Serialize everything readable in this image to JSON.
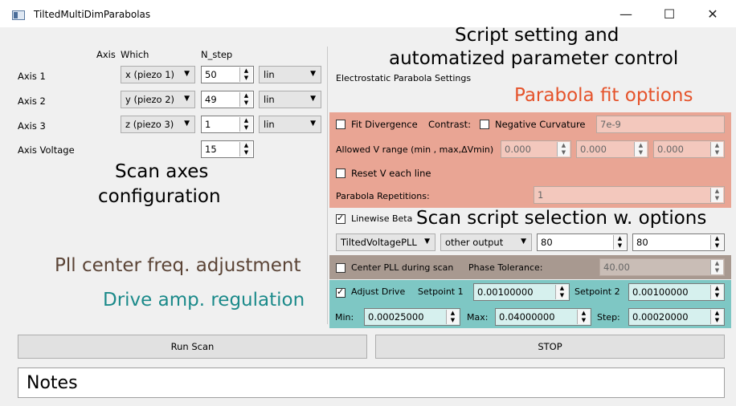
{
  "window": {
    "title": "TiltedMultiDimParabolas",
    "min_glyph": "—",
    "max_glyph": "☐",
    "close_glyph": "✕"
  },
  "annotations": {
    "script_setting": "Script setting and",
    "automatized": "automatized parameter control",
    "parabola_fit": "Parabola fit options",
    "scan_axes_1": "Scan axes",
    "scan_axes_2": "configuration",
    "scan_script": "Scan script selection w. options",
    "pll_center": "Pll center freq. adjustment",
    "drive_amp": "Drive amp. regulation",
    "colors": {
      "parabola": "#e5532b",
      "pll": "#5b4436",
      "drive": "#1b8a8a"
    }
  },
  "axes": {
    "header_axis": "Axis",
    "header_which": "Which",
    "header_nstep": "N_step",
    "rows": [
      {
        "label": "Axis 1",
        "which": "x (piezo 1)",
        "nstep": "50",
        "mode": "lin"
      },
      {
        "label": "Axis 2",
        "which": "y (piezo 2)",
        "nstep": "49",
        "mode": "lin"
      },
      {
        "label": "Axis 3",
        "which": "z (piezo 3)",
        "nstep": "1",
        "mode": "lin"
      }
    ],
    "voltage_label": "Axis Voltage",
    "voltage_value": "15"
  },
  "settings": {
    "title": "Electrostatic Parabola Settings",
    "fit_divergence": "Fit Divergence",
    "contrast": "Contrast:",
    "negative_curvature": "Negative Curvature",
    "curvature_value": "7e-9",
    "allowed_v": "Allowed V range (min , max,ΔVmin)",
    "v_min": "0.000",
    "v_max": "0.000",
    "v_delta": "0.000",
    "reset_v": "Reset V each line",
    "parabola_reps": "Parabola Repetitions:",
    "reps_value": "1",
    "linewise_beta": "Linewise Beta",
    "script_select": "TiltedVoltagePLL",
    "output_select": "other output",
    "spin_a": "80",
    "spin_b": "80",
    "center_pll": "Center PLL during scan",
    "phase_tol": "Phase Tolerance:",
    "phase_tol_value": "40.00",
    "adjust_drive": "Adjust Drive",
    "setpoint1_label": "Setpoint 1",
    "setpoint1": "0.00100000",
    "setpoint2_label": "Setpoint 2",
    "setpoint2": "0.00100000",
    "min_label": "Min:",
    "min_value": "0.00025000",
    "max_label": "Max:",
    "max_value": "0.04000000",
    "step_label": "Step:",
    "step_value": "0.00020000"
  },
  "buttons": {
    "run_scan": "Run Scan",
    "stop": "STOP"
  },
  "notes": "Notes"
}
